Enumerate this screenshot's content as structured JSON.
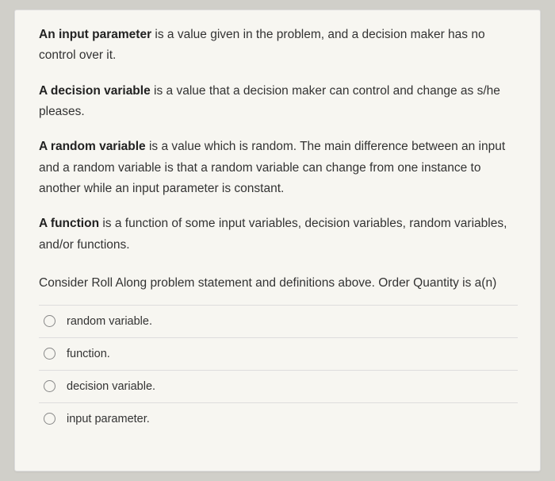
{
  "definitions": {
    "d1_term": "An input parameter",
    "d1_text": " is a value given in the problem, and a decision maker has no control over it.",
    "d2_term": "A decision variable",
    "d2_text": " is a value that a decision maker can control and change as s/he pleases.",
    "d3_term": "A random variable",
    "d3_text": " is a value which is random. The main difference between an input and a random variable is that a random variable can change from one instance to another while an input parameter is constant.",
    "d4_term": "A function",
    "d4_text": " is a function of some input variables, decision variables, random variables, and/or functions."
  },
  "question": "Consider Roll Along problem statement and definitions above. Order Quantity is a(n)",
  "options": {
    "o1": "random variable.",
    "o2": "function.",
    "o3": "decision variable.",
    "o4": "input parameter."
  }
}
